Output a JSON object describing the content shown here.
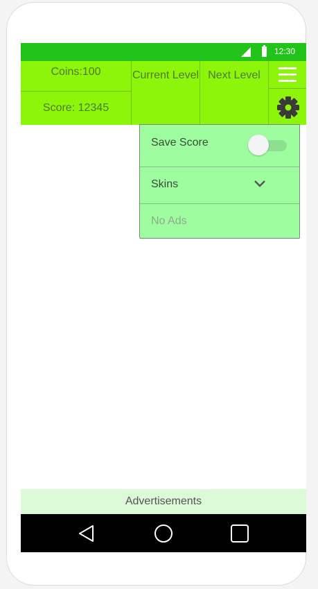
{
  "status_bar": {
    "time": "12:30",
    "icons": [
      "signal-icon",
      "battery-icon"
    ]
  },
  "top_bar": {
    "coins_label": "Coins:100",
    "score_label": "Score: 12345",
    "current_level_label": "Current Level",
    "next_level_label": "Next Level",
    "menu_icon": "hamburger-menu-icon",
    "settings_icon": "gear-icon"
  },
  "settings_menu": {
    "save_score_label": "Save Score",
    "save_score_toggle": "off",
    "skins_label": "Skins",
    "skins_icon": "chevron-down-icon",
    "no_ads_label": "No Ads"
  },
  "ads_banner": {
    "label": "Advertisements"
  },
  "nav_bar": {
    "icons": [
      "back-icon",
      "home-icon",
      "recents-icon"
    ]
  },
  "colors": {
    "status_bar": "#22c31b",
    "top_bar": "#8cf50a",
    "dropdown": "#9dfd9f",
    "ads_banner": "#dcf9d8",
    "nav_bar": "#000000"
  }
}
